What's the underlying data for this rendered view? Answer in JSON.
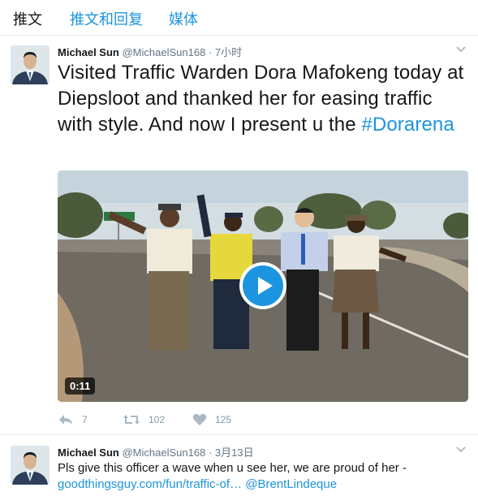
{
  "tabs": [
    {
      "label": "推文"
    },
    {
      "label": "推文和回复"
    },
    {
      "label": "媒体"
    }
  ],
  "tweets": [
    {
      "name": "Michael Sun",
      "handle": "@MichaelSun168",
      "dot": "·",
      "time": "7小时",
      "text": "Visited Traffic Warden Dora Mafokeng today at Diepsloot and thanked her for easing traffic with style. And now I present u the ",
      "hashtag": "#Dorarena",
      "media": {
        "duration": "0:11"
      },
      "actions": {
        "replies": "7",
        "retweets": "102",
        "likes": "125"
      }
    },
    {
      "name": "Michael Sun",
      "handle": "@MichaelSun168",
      "dot": "·",
      "time": "3月13日",
      "text": "Pls give this officer a wave when u see her, we are proud of her - ",
      "link": "goodthingsguy.com/fun/traffic-of…",
      "mention": "@BrentLindeque"
    }
  ],
  "colors": {
    "accent": "#1c94e0",
    "muted": "#657786",
    "action": "#8899a6"
  }
}
